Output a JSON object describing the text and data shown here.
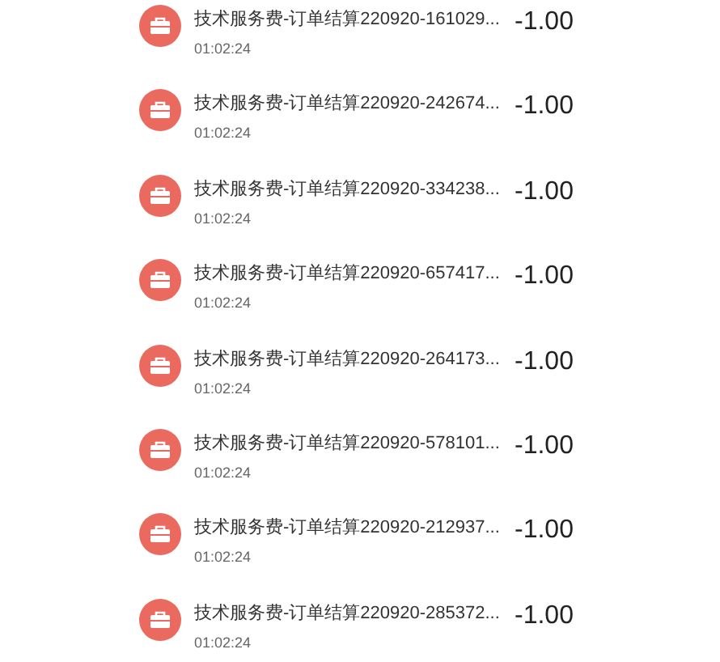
{
  "transactions": [
    {
      "title": "技术服务费-订单结算220920-161029...",
      "time": "01:02:24",
      "amount": "-1.00"
    },
    {
      "title": "技术服务费-订单结算220920-242674...",
      "time": "01:02:24",
      "amount": "-1.00"
    },
    {
      "title": "技术服务费-订单结算220920-334238...",
      "time": "01:02:24",
      "amount": "-1.00"
    },
    {
      "title": "技术服务费-订单结算220920-657417...",
      "time": "01:02:24",
      "amount": "-1.00"
    },
    {
      "title": "技术服务费-订单结算220920-264173...",
      "time": "01:02:24",
      "amount": "-1.00"
    },
    {
      "title": "技术服务费-订单结算220920-578101...",
      "time": "01:02:24",
      "amount": "-1.00"
    },
    {
      "title": "技术服务费-订单结算220920-212937...",
      "time": "01:02:24",
      "amount": "-1.00"
    },
    {
      "title": "技术服务费-订单结算220920-285372...",
      "time": "01:02:24",
      "amount": "-1.00"
    }
  ]
}
